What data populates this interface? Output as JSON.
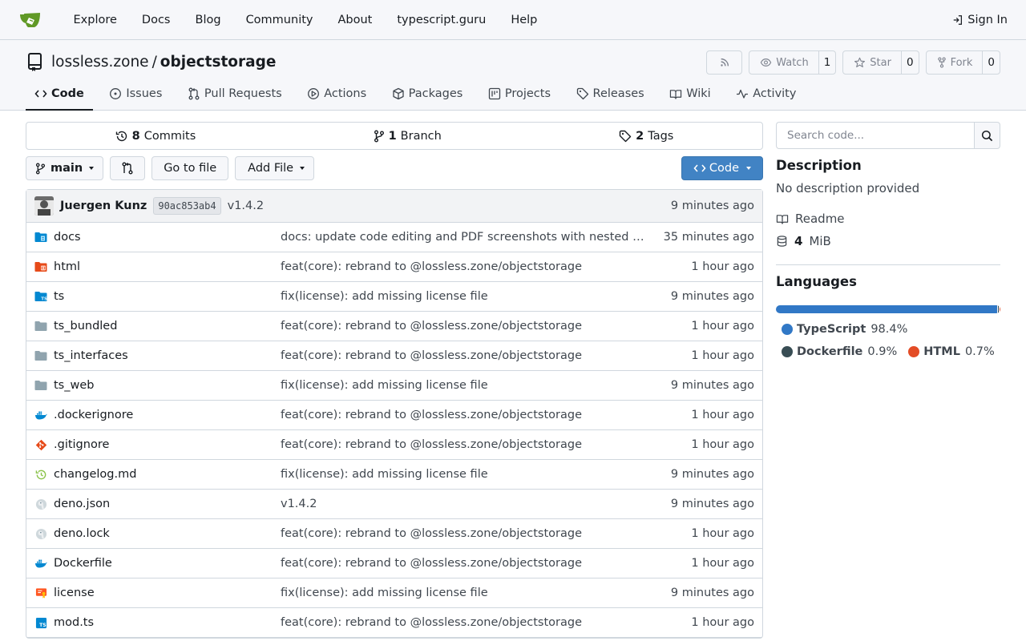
{
  "nav": {
    "links": [
      "Explore",
      "Docs",
      "Blog",
      "Community",
      "About",
      "typescript.guru",
      "Help"
    ],
    "signin": "Sign In"
  },
  "repo": {
    "owner": "lossless.zone",
    "sep": "/",
    "name": "objectstorage",
    "watch_label": "Watch",
    "watch_count": "1",
    "star_label": "Star",
    "star_count": "0",
    "fork_label": "Fork",
    "fork_count": "0"
  },
  "tabs": [
    {
      "label": "Code",
      "icon": "code-icon"
    },
    {
      "label": "Issues",
      "icon": "issue-icon"
    },
    {
      "label": "Pull Requests",
      "icon": "pull-request-icon"
    },
    {
      "label": "Actions",
      "icon": "play-icon"
    },
    {
      "label": "Packages",
      "icon": "package-icon"
    },
    {
      "label": "Projects",
      "icon": "project-icon"
    },
    {
      "label": "Releases",
      "icon": "tag-icon"
    },
    {
      "label": "Wiki",
      "icon": "book-icon"
    },
    {
      "label": "Activity",
      "icon": "pulse-icon"
    }
  ],
  "stats": {
    "commits_count": "8",
    "commits_label": "Commits",
    "branch_count": "1",
    "branch_label": "Branch",
    "tags_count": "2",
    "tags_label": "Tags"
  },
  "toolbar": {
    "branch": "main",
    "goto_file": "Go to file",
    "add_file": "Add File",
    "code_button": "Code"
  },
  "latest_commit": {
    "author": "Juergen Kunz",
    "sha": "90ac853ab4",
    "message": "v1.4.2",
    "time": "9 minutes ago"
  },
  "files": [
    {
      "name": "docs",
      "icon": "folder-docs-icon",
      "message": "docs: update code editing and PDF screenshots with nested folder support",
      "time": "35 minutes ago"
    },
    {
      "name": "html",
      "icon": "folder-html-icon",
      "message": "feat(core): rebrand to @lossless.zone/objectstorage",
      "time": "1 hour ago"
    },
    {
      "name": "ts",
      "icon": "folder-ts-icon",
      "message": "fix(license): add missing license file",
      "time": "9 minutes ago"
    },
    {
      "name": "ts_bundled",
      "icon": "folder-icon",
      "message": "feat(core): rebrand to @lossless.zone/objectstorage",
      "time": "1 hour ago"
    },
    {
      "name": "ts_interfaces",
      "icon": "folder-icon",
      "message": "feat(core): rebrand to @lossless.zone/objectstorage",
      "time": "1 hour ago"
    },
    {
      "name": "ts_web",
      "icon": "folder-icon",
      "message": "fix(license): add missing license file",
      "time": "9 minutes ago"
    },
    {
      "name": ".dockerignore",
      "icon": "docker-icon",
      "message": "feat(core): rebrand to @lossless.zone/objectstorage",
      "time": "1 hour ago"
    },
    {
      "name": ".gitignore",
      "icon": "git-icon",
      "message": "feat(core): rebrand to @lossless.zone/objectstorage",
      "time": "1 hour ago"
    },
    {
      "name": "changelog.md",
      "icon": "changelog-icon",
      "message": "fix(license): add missing license file",
      "time": "9 minutes ago"
    },
    {
      "name": "deno.json",
      "icon": "deno-icon",
      "message": "v1.4.2",
      "time": "9 minutes ago"
    },
    {
      "name": "deno.lock",
      "icon": "deno-icon",
      "message": "feat(core): rebrand to @lossless.zone/objectstorage",
      "time": "1 hour ago"
    },
    {
      "name": "Dockerfile",
      "icon": "docker-icon",
      "message": "feat(core): rebrand to @lossless.zone/objectstorage",
      "time": "1 hour ago"
    },
    {
      "name": "license",
      "icon": "license-icon",
      "message": "fix(license): add missing license file",
      "time": "9 minutes ago"
    },
    {
      "name": "mod.ts",
      "icon": "typescript-file-icon",
      "message": "feat(core): rebrand to @lossless.zone/objectstorage",
      "time": "1 hour ago"
    }
  ],
  "sidebar": {
    "search_placeholder": "Search code...",
    "description_heading": "Description",
    "description_text": "No description provided",
    "readme": "Readme",
    "size_value": "4",
    "size_unit": "MiB",
    "languages_heading": "Languages"
  },
  "languages": [
    {
      "name": "TypeScript",
      "percent": "98.4%",
      "value": 98.4,
      "color": "#3178c6"
    },
    {
      "name": "Dockerfile",
      "percent": "0.9%",
      "value": 0.9,
      "color": "#384d54"
    },
    {
      "name": "HTML",
      "percent": "0.7%",
      "value": 0.7,
      "color": "#e34c26"
    }
  ],
  "colors": {
    "accent": "#4183c4",
    "border": "#d0d7de",
    "header_bg": "#f6f7fa",
    "brand_green": "#609926"
  }
}
